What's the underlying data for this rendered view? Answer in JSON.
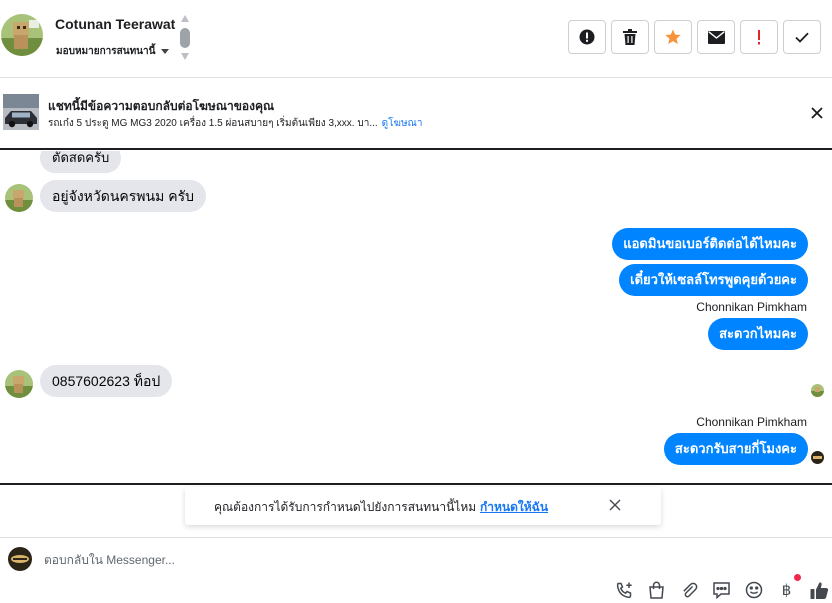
{
  "header": {
    "contact_name": "Cotunan Teerawat",
    "assign_label": "มอบหมายการสนทนานี้",
    "toolbar": [
      {
        "name": "mark-spam-button",
        "icon": "alert-circle-icon"
      },
      {
        "name": "delete-button",
        "icon": "trash-icon"
      },
      {
        "name": "star-button",
        "icon": "star-icon",
        "color": "#f7923b"
      },
      {
        "name": "mark-unread-button",
        "icon": "envelope-icon"
      },
      {
        "name": "follow-up-button",
        "icon": "exclamation-icon",
        "color": "#e02828"
      },
      {
        "name": "mark-done-button",
        "icon": "check-icon"
      }
    ]
  },
  "ad": {
    "title": "แชทนี้มีข้อความตอบกลับต่อโฆษณาของคุณ",
    "description": "รถเก๋ง 5 ประตู MG MG3 2020 เครื่อง 1.5 ผ่อนสบายๆ เริ่มต้นเพียง 3,xxx. บา...",
    "link": "ดูโฆษณา"
  },
  "messages": {
    "in_1": "ตัดสดครับ",
    "in_2": "อยู่จังหวัดนครพนม ครับ",
    "out_1": "แอดมินขอเบอร์ติดต่อได้ไหมคะ",
    "out_2": "เดี๋ยวให้เซลล์โทรพูดคุยด้วยคะ",
    "sender_1": "Chonnikan Pimkham",
    "out_3": "สะดวกไหมคะ",
    "in_3": "0857602623 ท็อป",
    "sender_2": "Chonnikan Pimkham",
    "out_4": "สะดวกรับสายกี่โมงคะ"
  },
  "notice": {
    "text": "คุณต้องการได้รับการกำหนดไปยังการสนทนานี้ไหม",
    "link": "กำหนดให้ฉัน"
  },
  "composer": {
    "placeholder": "ตอบกลับใน Messenger...",
    "actions": [
      "add-call-icon",
      "shopping-bag-icon",
      "attachment-icon",
      "saved-replies-icon",
      "emoji-icon",
      "baht-payment-icon",
      "like-icon"
    ],
    "baht_symbol": "฿",
    "colors": {
      "accent": "#0084ff",
      "link": "#1877f2",
      "incoming": "#e4e6eb",
      "notification_dot": "#f02849"
    }
  }
}
